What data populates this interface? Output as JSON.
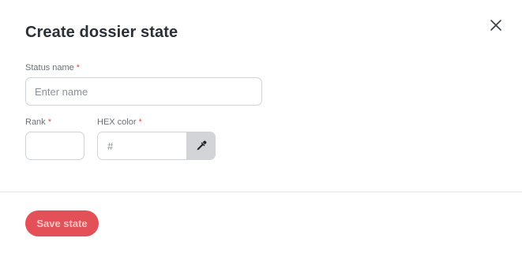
{
  "dialog": {
    "title": "Create dossier state",
    "close_icon": "close-icon"
  },
  "form": {
    "status_name": {
      "label": "Status name",
      "required_marker": "*",
      "value": "",
      "placeholder": "Enter name"
    },
    "rank": {
      "label": "Rank",
      "required_marker": "*",
      "value": "",
      "placeholder": ""
    },
    "hex_color": {
      "label": "HEX color",
      "required_marker": "*",
      "value": "",
      "placeholder": "#",
      "picker_icon": "eyedropper-icon"
    }
  },
  "footer": {
    "save_label": "Save state"
  },
  "colors": {
    "accent": "#e35057",
    "required": "#e04b52",
    "title": "#2b2f36",
    "picker_bg": "#d3d4d8"
  }
}
